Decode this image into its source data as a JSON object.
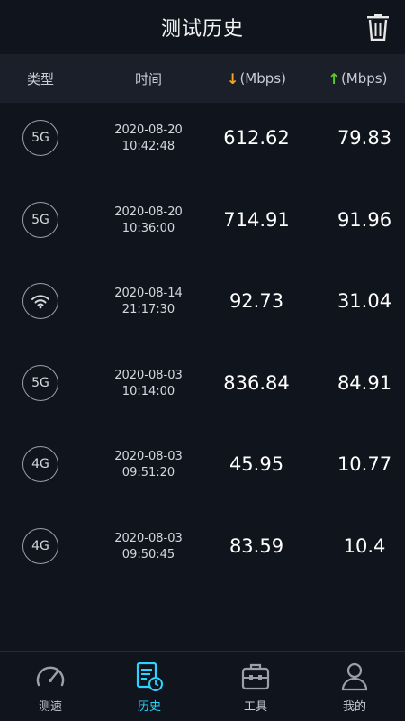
{
  "header": {
    "title": "测试历史",
    "delete_icon": "trash-icon"
  },
  "columns": {
    "type": "类型",
    "time": "时间",
    "down_unit": "(Mbps)",
    "up_unit": "(Mbps)",
    "down_color": "#f5a623",
    "up_color": "#5ccb2c"
  },
  "records": [
    {
      "type": "5G",
      "date": "2020-08-20",
      "time": "10:42:48",
      "down": "612.62",
      "up": "79.83"
    },
    {
      "type": "5G",
      "date": "2020-08-20",
      "time": "10:36:00",
      "down": "714.91",
      "up": "91.96"
    },
    {
      "type": "wifi",
      "date": "2020-08-14",
      "time": "21:17:30",
      "down": "92.73",
      "up": "31.04"
    },
    {
      "type": "5G",
      "date": "2020-08-03",
      "time": "10:14:00",
      "down": "836.84",
      "up": "84.91"
    },
    {
      "type": "4G",
      "date": "2020-08-03",
      "time": "09:51:20",
      "down": "45.95",
      "up": "10.77"
    },
    {
      "type": "4G",
      "date": "2020-08-03",
      "time": "09:50:45",
      "down": "83.59",
      "up": "10.4"
    }
  ],
  "tabs": [
    {
      "label": "测速",
      "icon": "speedometer-icon",
      "active": false
    },
    {
      "label": "历史",
      "icon": "history-icon",
      "active": true
    },
    {
      "label": "工具",
      "icon": "toolbox-icon",
      "active": false
    },
    {
      "label": "我的",
      "icon": "user-icon",
      "active": false
    }
  ],
  "accent_color": "#2ad4ff"
}
